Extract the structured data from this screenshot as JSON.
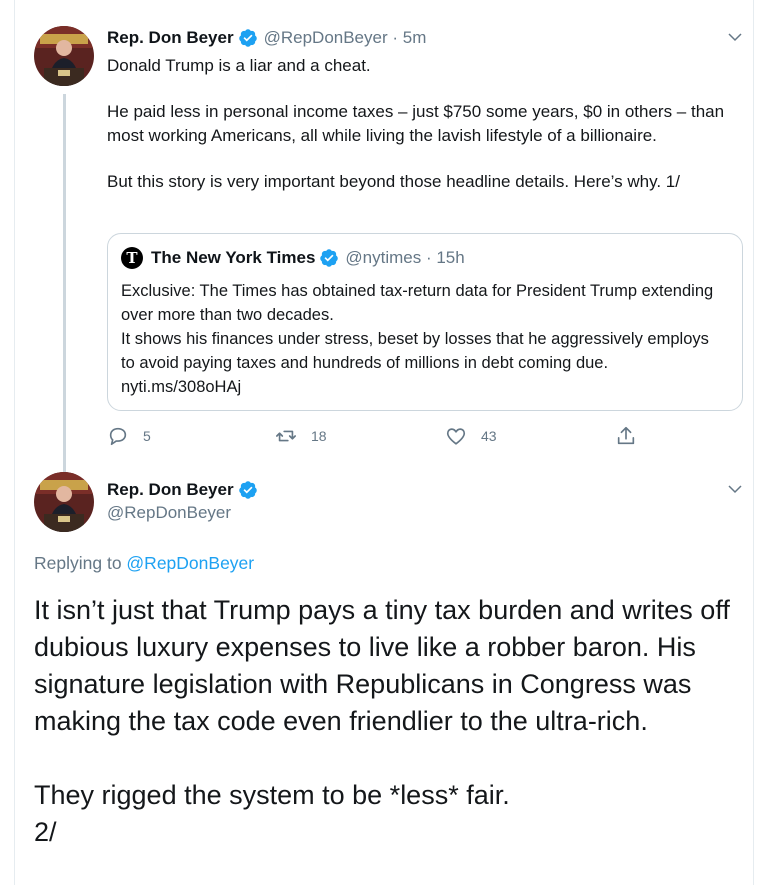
{
  "tweet1": {
    "author_name": "Rep. Don Beyer",
    "author_handle": "@RepDonBeyer · 5m",
    "paragraphs": [
      "Donald Trump is a liar and a cheat.",
      "He paid less in personal income taxes – just $750 some years, $0 in others – than most working Americans, all while living the lavish lifestyle of a billionaire.",
      "But this story is very important beyond those headline details. Here’s why. 1/"
    ],
    "quote": {
      "logo_letter": "T",
      "author_name": "The New York Times",
      "author_handle": "@nytimes · 15h",
      "line1": "Exclusive: The Times has obtained tax-return data for President Trump extending over more than two decades.",
      "line2": "It shows his finances under stress, beset by losses that he aggressively employs to avoid paying taxes and hundreds of millions in debt coming due. nyti.ms/308oHAj"
    },
    "actions": {
      "reply_count": "5",
      "retweet_count": "18",
      "like_count": "43"
    }
  },
  "tweet2": {
    "author_name": "Rep. Don Beyer",
    "author_handle": "@RepDonBeyer",
    "replying_prefix": "Replying to ",
    "replying_handle": "@RepDonBeyer",
    "paragraph1": "It isn’t just that Trump pays a tiny tax burden and writes off dubious luxury expenses to live like a robber baron. His signature legislation with Republicans in Congress was making the tax code even friendlier to the ultra-rich.",
    "paragraph2": "They rigged the system to be *less* fair.\n2/"
  },
  "colors": {
    "verified": "#1da1f2",
    "secondary_text": "#657786",
    "link": "#1da1f2"
  }
}
